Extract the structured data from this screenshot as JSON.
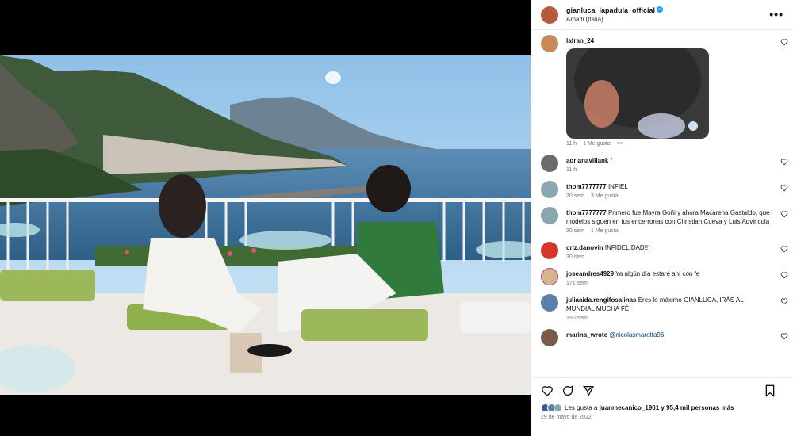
{
  "post": {
    "username": "gianluca_lapadula_official",
    "location": "Amalfi (Italia)",
    "more_label": "•••"
  },
  "comments": [
    {
      "user": "lafran_24",
      "text": "",
      "time": "11 h",
      "likes": "1 Me gusta",
      "extra": "•••"
    },
    {
      "user": "adrianavillank",
      "text": "f",
      "time": "11 h",
      "likes": ""
    },
    {
      "user": "thom7777777",
      "text": "INFIEL",
      "time": "30 sem",
      "likes": "3 Me gusta"
    },
    {
      "user": "thom7777777",
      "text": "Primero fue Mayra Goñi y ahora Macarena Gastaldo, que modelos siguen en tus encerronas con Christian Cueva y Luis Advincula",
      "time": "30 sem",
      "likes": "1 Me gusta"
    },
    {
      "user": "criz.danovin",
      "text": "INFIDELIDAD!!!",
      "time": "30 sem",
      "likes": ""
    },
    {
      "user": "joseandres4929",
      "text": "Ya algún día estaré ahí con fe",
      "time": "171 sem",
      "likes": ""
    },
    {
      "user": "juliaaida.rengifosalinas",
      "text": "Eres lo máximo GIANLUCA, IRÁS AL MUNDIAL MUCHA FÉ.",
      "time": "190 sem",
      "likes": ""
    },
    {
      "user": "marina_wrote",
      "text": "@nicolasmarotta96",
      "time": "",
      "likes": ""
    }
  ],
  "footer": {
    "likes_prefix": "Les gusta a ",
    "likes_user": "juanmecanico_1901",
    "likes_suffix": " y 95,4 mil personas más",
    "date": "29 de mayo de 2022"
  },
  "colors": {
    "verified": "#1d9bf0",
    "mention": "#00376b",
    "meta": "#737373"
  },
  "icons": [
    "heart-icon",
    "comment-icon",
    "share-icon",
    "bookmark-icon",
    "more-icon",
    "verified-icon"
  ]
}
